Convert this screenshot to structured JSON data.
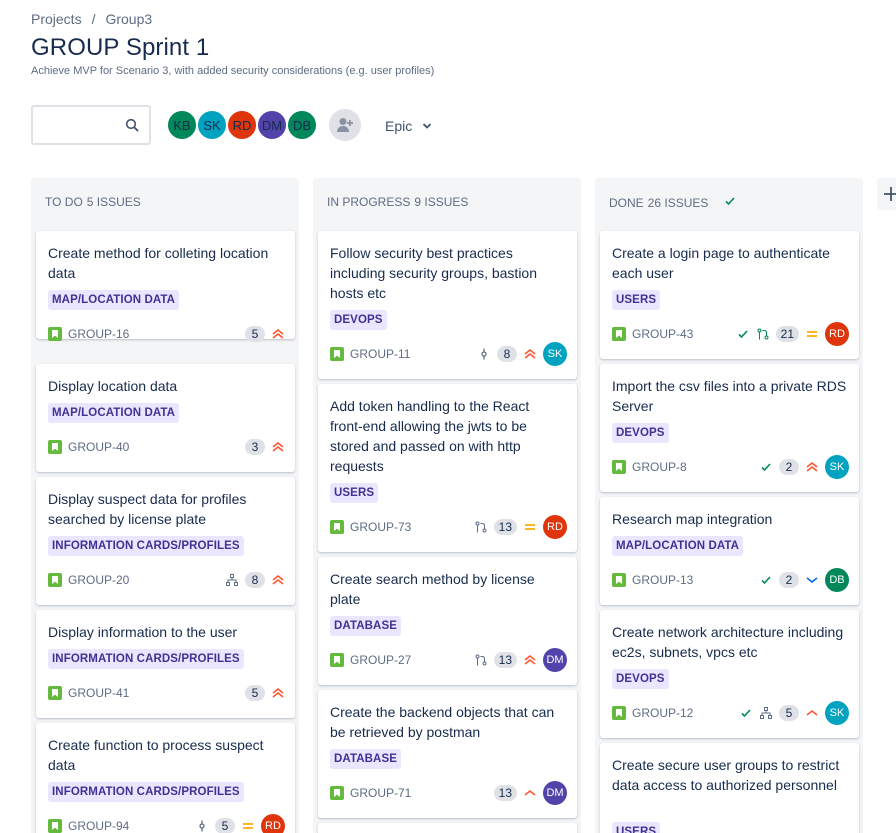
{
  "breadcrumb": {
    "projects": "Projects",
    "separator": "/",
    "group": "Group3"
  },
  "title": "GROUP Sprint 1",
  "subtitle": "Achieve MVP for Scenario 3, with added security considerations (e.g. user profiles)",
  "search": {
    "value": "",
    "placeholder": ""
  },
  "avatars": [
    {
      "initials": "KB",
      "color": "#00875a"
    },
    {
      "initials": "SK",
      "color": "#00a3bf"
    },
    {
      "initials": "RD",
      "color": "#de350b"
    },
    {
      "initials": "DM",
      "color": "#5243aa"
    },
    {
      "initials": "DB",
      "color": "#00875a"
    }
  ],
  "filter": {
    "epic_label": "Epic"
  },
  "colors": {
    "label_bg": "#eae6ff",
    "label_text": "#403294",
    "story": "#63ba3c",
    "priority_high": "#ff5630",
    "priority_medium": "#ffab00",
    "priority_low": "#0065ff",
    "done_check": "#00875a"
  },
  "columns": [
    {
      "name": "TO DO",
      "count": "5 ISSUES"
    },
    {
      "name": "IN PROGRESS",
      "count": "9 ISSUES"
    },
    {
      "name": "DONE",
      "count": "26 ISSUES"
    }
  ],
  "cards": {
    "todo": [
      {
        "title": "Create method for colleting location data",
        "label": "MAP/LOCATION DATA",
        "key": "GROUP-16",
        "points": "5"
      },
      {
        "title": "Display location data",
        "label": "MAP/LOCATION DATA",
        "key": "GROUP-40",
        "points": "3"
      },
      {
        "title": "Display suspect data for profiles searched by license plate",
        "label": "INFORMATION CARDS/PROFILES",
        "key": "GROUP-20",
        "points": "8"
      },
      {
        "title": "Display information to the user",
        "label": "INFORMATION CARDS/PROFILES",
        "key": "GROUP-41",
        "points": "5"
      },
      {
        "title": "Create function to process suspect data",
        "label": "INFORMATION CARDS/PROFILES",
        "key": "GROUP-94",
        "points": "5",
        "assignee": "RD"
      }
    ],
    "progress": [
      {
        "title": "Follow security best practices including security groups, bastion hosts etc",
        "label": "DEVOPS",
        "key": "GROUP-11",
        "points": "8",
        "assignee": "SK"
      },
      {
        "title": "Add token handling to the React front-end allowing the jwts to be stored and passed on with http requests",
        "label": "USERS",
        "key": "GROUP-73",
        "points": "13",
        "assignee": "RD"
      },
      {
        "title": "Create search method by license plate",
        "label": "DATABASE",
        "key": "GROUP-27",
        "points": "13",
        "assignee": "DM"
      },
      {
        "title": "Create the backend objects that can be retrieved by postman",
        "label": "DATABASE",
        "key": "GROUP-71",
        "points": "13",
        "assignee": "DM"
      }
    ],
    "done": [
      {
        "title": "Create a login page to authenticate each user",
        "label": "USERS",
        "key": "GROUP-43",
        "points": "21",
        "assignee": "RD"
      },
      {
        "title": "Import the csv files into a private RDS Server",
        "label": "DEVOPS",
        "key": "GROUP-8",
        "points": "2",
        "assignee": "SK"
      },
      {
        "title": "Research map integration",
        "label": "MAP/LOCATION DATA",
        "key": "GROUP-13",
        "points": "2",
        "assignee": "DB"
      },
      {
        "title": "Create network architecture including ec2s, subnets, vpcs etc",
        "label": "DEVOPS",
        "key": "GROUP-12",
        "points": "5",
        "assignee": "SK"
      },
      {
        "title": "Create secure user groups to restrict data access to authorized personnel",
        "label": "USERS"
      }
    ]
  }
}
